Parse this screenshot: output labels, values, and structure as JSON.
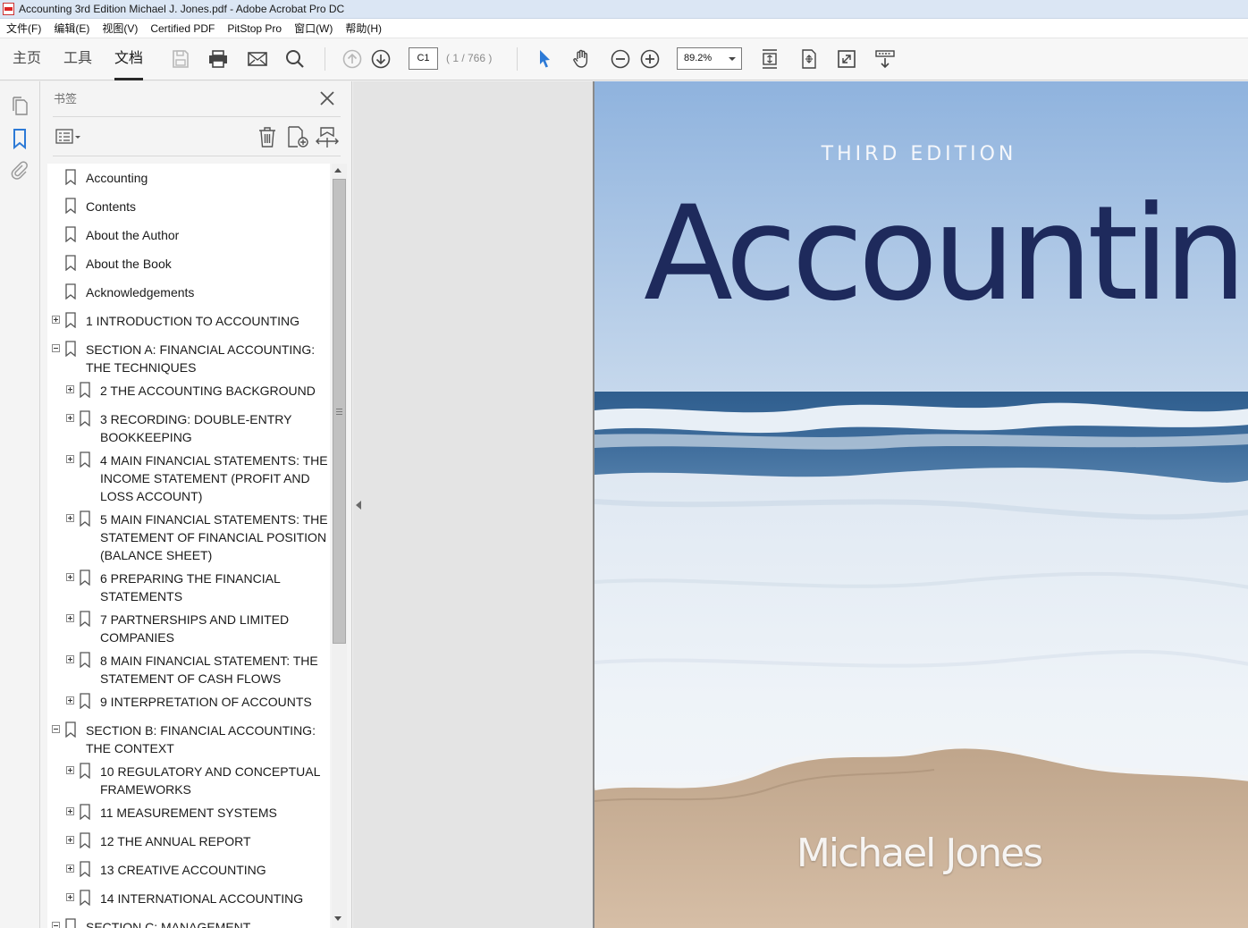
{
  "window": {
    "title": "Accounting 3rd Edition Michael J. Jones.pdf - Adobe Acrobat Pro DC"
  },
  "menu": [
    "文件(F)",
    "编辑(E)",
    "视图(V)",
    "Certified PDF",
    "PitStop Pro",
    "窗口(W)",
    "帮助(H)"
  ],
  "toolbar": {
    "tabs": [
      "主页",
      "工具",
      "文档"
    ],
    "active_tab": "文档",
    "page_input": "C1",
    "page_count": "( 1 / 766 )",
    "zoom": "89.2%"
  },
  "bookmarks_panel": {
    "title": "书签",
    "items": [
      {
        "label": "Accounting"
      },
      {
        "label": "Contents"
      },
      {
        "label": "About the Author"
      },
      {
        "label": "About the Book"
      },
      {
        "label": "Acknowledgements"
      },
      {
        "label": "1 INTRODUCTION TO ACCOUNTING"
      },
      {
        "label": "SECTION A: FINANCIAL ACCOUNTING:\nTHE TECHNIQUES"
      },
      {
        "label": "2 THE ACCOUNTING BACKGROUND"
      },
      {
        "label": "3 RECORDING: DOUBLE-ENTRY\nBOOKKEEPING"
      },
      {
        "label": "4 MAIN FINANCIAL STATEMENTS: THE\nINCOME STATEMENT (PROFIT AND\nLOSS ACCOUNT)"
      },
      {
        "label": "5 MAIN FINANCIAL STATEMENTS: THE\nSTATEMENT OF FINANCIAL POSITION\n(BALANCE SHEET)"
      },
      {
        "label": "6 PREPARING THE FINANCIAL\nSTATEMENTS"
      },
      {
        "label": "7 PARTNERSHIPS AND LIMITED\nCOMPANIES"
      },
      {
        "label": "8 MAIN FINANCIAL STATEMENT: THE\nSTATEMENT OF CASH FLOWS"
      },
      {
        "label": "9 INTERPRETATION OF ACCOUNTS"
      },
      {
        "label": "SECTION B: FINANCIAL ACCOUNTING:\nTHE CONTEXT"
      },
      {
        "label": "10 REGULATORY AND CONCEPTUAL\nFRAMEWORKS"
      },
      {
        "label": "11 MEASUREMENT SYSTEMS"
      },
      {
        "label": "12 THE ANNUAL REPORT"
      },
      {
        "label": "13 CREATIVE ACCOUNTING"
      },
      {
        "label": "14 INTERNATIONAL ACCOUNTING"
      },
      {
        "label": "SECTION C: MANAGEMENT"
      }
    ]
  },
  "cover": {
    "edition": "THIRD EDITION",
    "title": "Accounting",
    "author": "Michael Jones",
    "colors": {
      "title": "#1e2a5c",
      "sky_top": "#8fb3de",
      "sky_bottom": "#c6d8ec",
      "sea": "#3f6d9c",
      "sand": "#cdb49a"
    }
  },
  "icons": {
    "rail": [
      "pages-icon",
      "bookmark-icon",
      "attachment-icon"
    ],
    "panel_tools": [
      "options-menu-icon",
      "delete-bookmark-icon",
      "new-bookmark-icon",
      "expand-bookmark-icon"
    ]
  }
}
